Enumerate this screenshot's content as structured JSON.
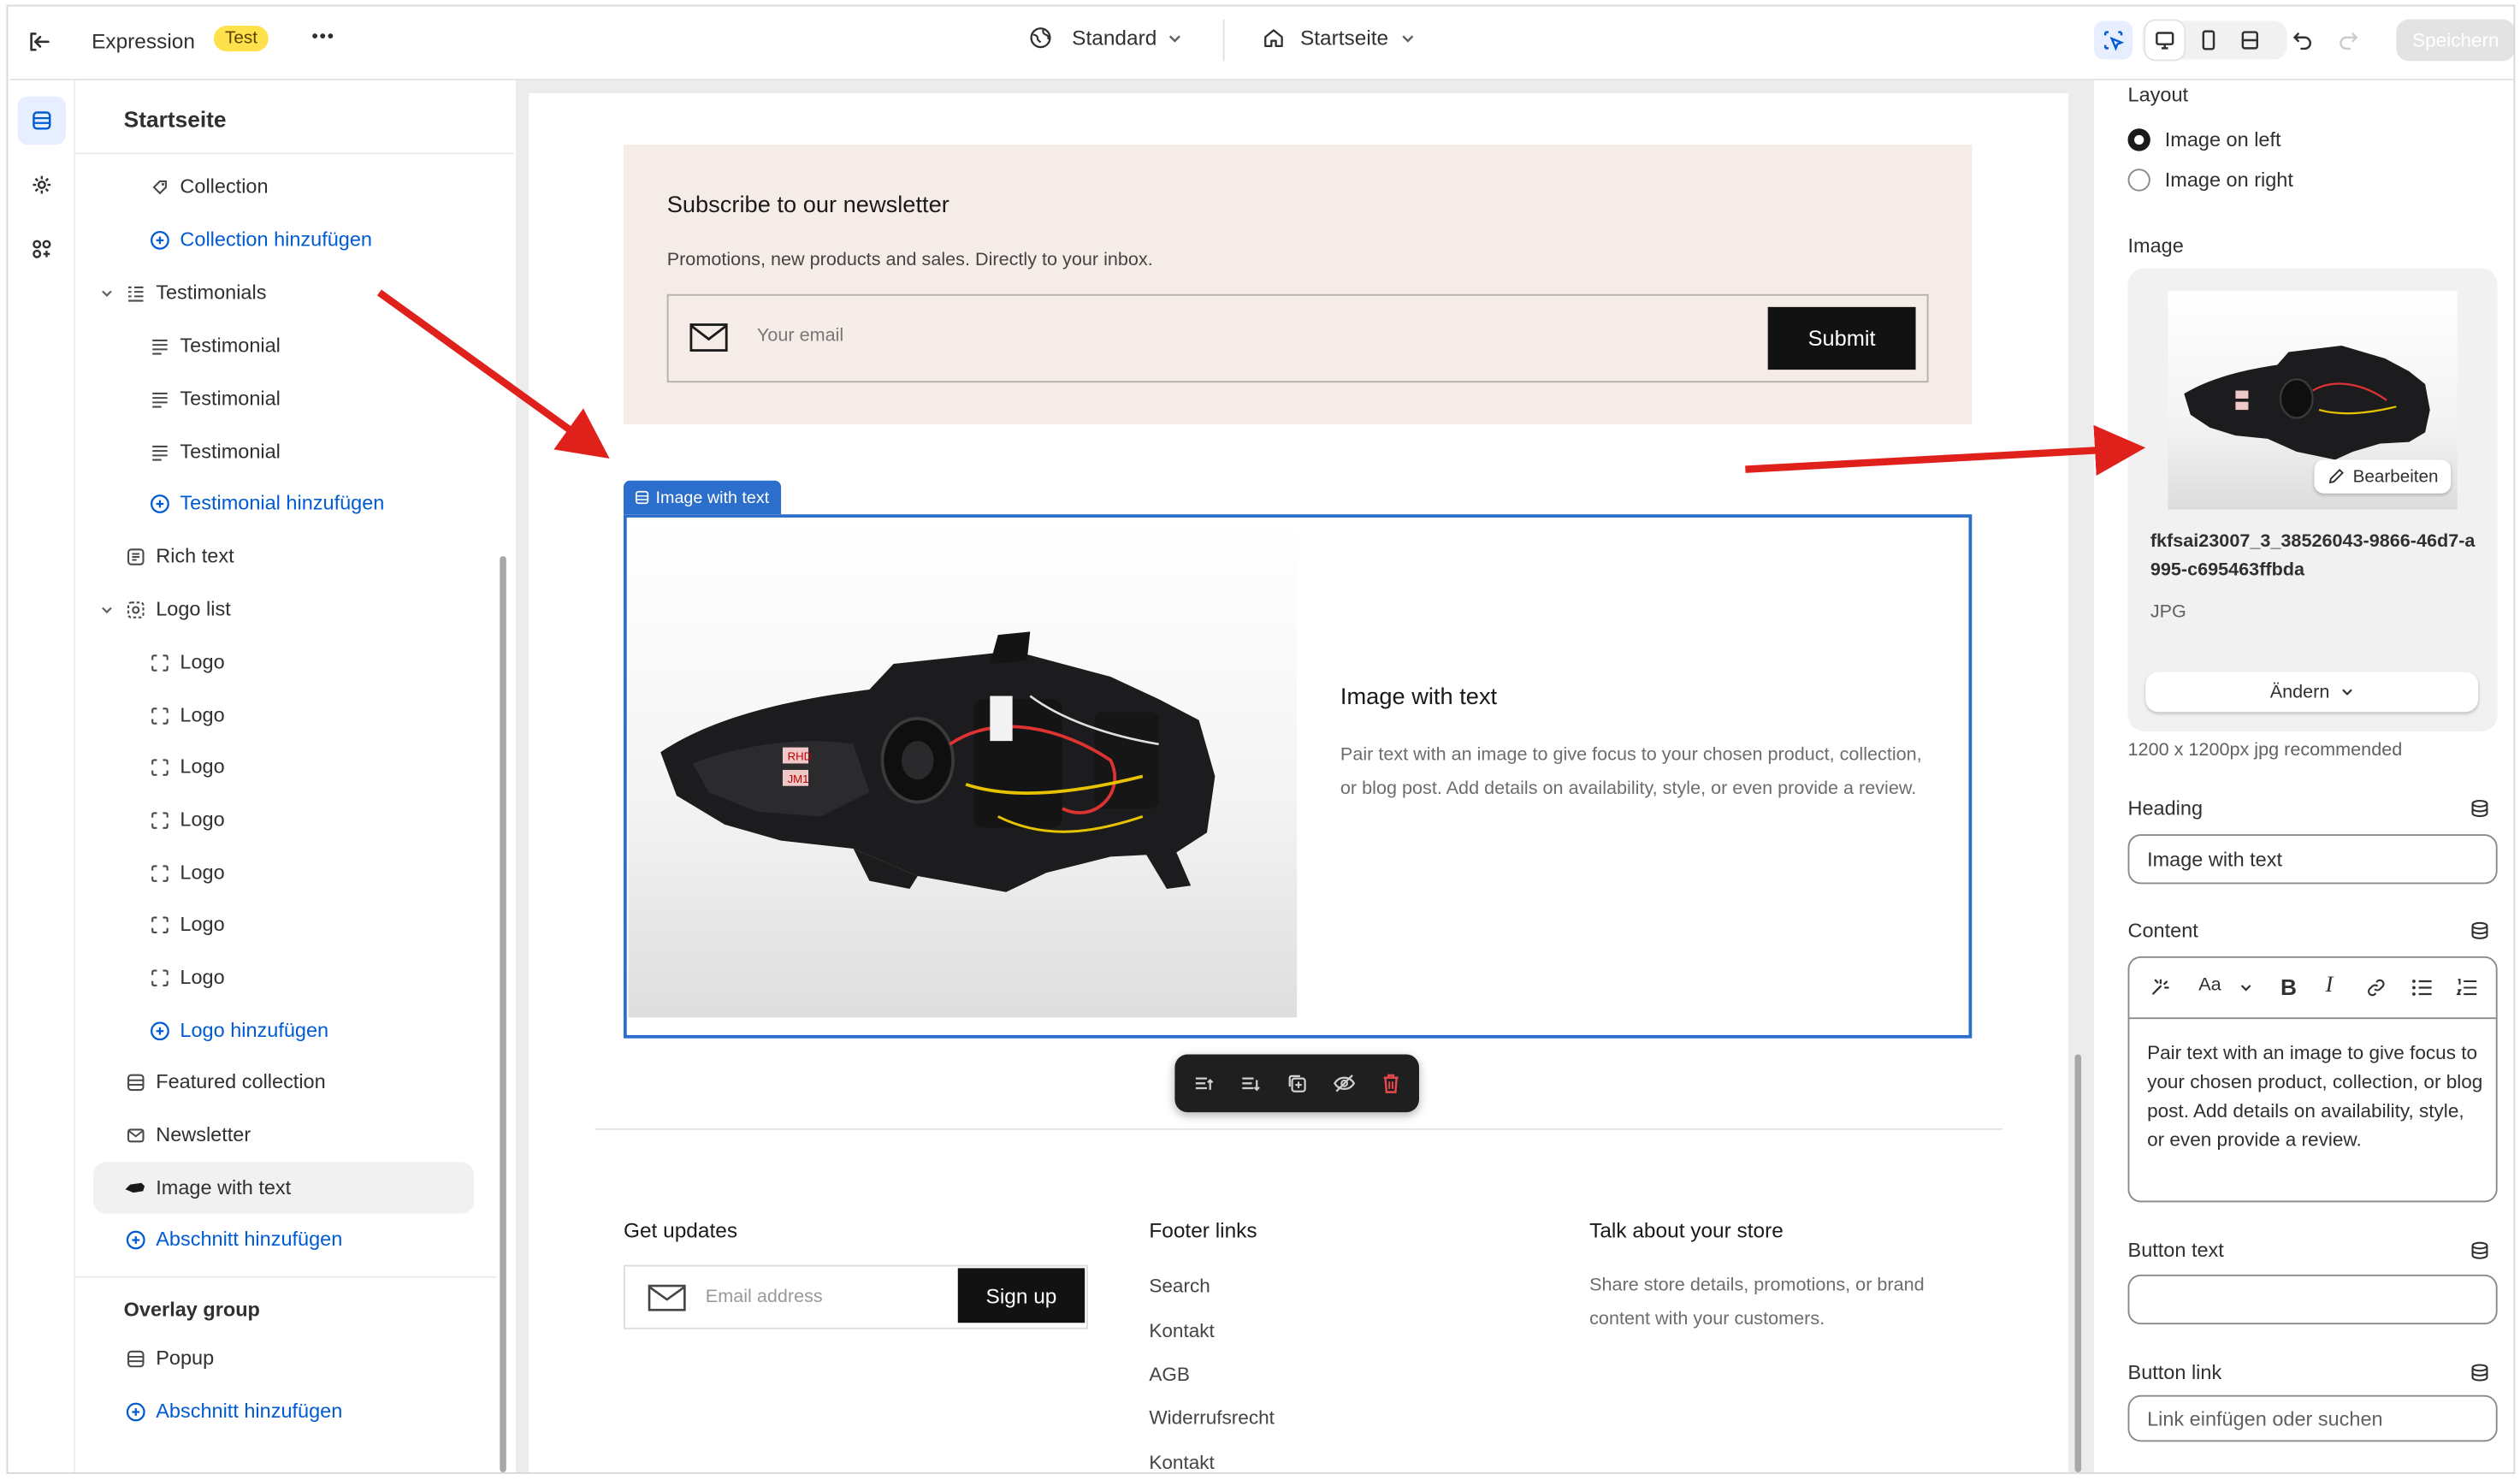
{
  "topbar": {
    "title": "Expression",
    "badge": "Test",
    "more": "•••",
    "theme_select": "Standard",
    "page_select": "Startseite",
    "save_label": "Speichern"
  },
  "left_panel": {
    "title": "Startseite",
    "items": [
      {
        "label": "Collection"
      },
      {
        "label": "Collection hinzufügen"
      },
      {
        "label": "Testimonials"
      },
      {
        "label": "Testimonial"
      },
      {
        "label": "Testimonial"
      },
      {
        "label": "Testimonial"
      },
      {
        "label": "Testimonial hinzufügen"
      },
      {
        "label": "Rich text"
      },
      {
        "label": "Logo list"
      },
      {
        "label": "Logo"
      },
      {
        "label": "Logo"
      },
      {
        "label": "Logo"
      },
      {
        "label": "Logo"
      },
      {
        "label": "Logo"
      },
      {
        "label": "Logo"
      },
      {
        "label": "Logo"
      },
      {
        "label": "Logo hinzufügen"
      },
      {
        "label": "Featured collection"
      },
      {
        "label": "Newsletter"
      },
      {
        "label": "Image with text"
      },
      {
        "label": "Abschnitt hinzufügen"
      }
    ],
    "overlay_group_title": "Overlay group",
    "overlay_items": [
      {
        "label": "Popup"
      },
      {
        "label": "Abschnitt hinzufügen"
      }
    ]
  },
  "canvas": {
    "newsletter": {
      "heading": "Subscribe to our newsletter",
      "subtext": "Promotions, new products and sales. Directly to your inbox.",
      "email_placeholder": "Your email",
      "submit_label": "Submit"
    },
    "section_tag": "Image with text",
    "image_with_text": {
      "heading": "Image with text",
      "body": "Pair text with an image to give focus to your chosen product, collection, or blog post. Add details on availability, style, or even provide a review.",
      "image_labels": [
        "RHD",
        "JM1"
      ]
    },
    "footer": {
      "updates_heading": "Get updates",
      "email_placeholder": "Email address",
      "signup_label": "Sign up",
      "links_heading": "Footer links",
      "links": [
        "Search",
        "Kontakt",
        "AGB",
        "Widerrufsrecht",
        "Kontakt"
      ],
      "talk_heading": "Talk about your store",
      "talk_text": "Share store details, promotions, or brand content with your customers."
    }
  },
  "right_panel": {
    "layout_label": "Layout",
    "layout_options": [
      "Image on left",
      "Image on right"
    ],
    "layout_selected": "Image on left",
    "image_label": "Image",
    "edit_label": "Bearbeiten",
    "filename": "fkfsai23007_3_38526043-9866-46d7-a995-c695463ffbda",
    "filetype": "JPG",
    "change_label": "Ändern",
    "image_hint": "1200 x 1200px jpg recommended",
    "heading_label": "Heading",
    "heading_value": "Image with text",
    "content_label": "Content",
    "content_toolbar_font": "Aa",
    "content_value": "Pair text with an image to give focus to your chosen product, collection, or blog post. Add details on availability, style, or even provide a review.",
    "button_text_label": "Button text",
    "button_text_value": "",
    "button_link_label": "Button link",
    "button_link_placeholder": "Link einfügen oder suchen"
  },
  "colors": {
    "accent_blue": "#005bd3",
    "selection_blue": "#2c6ecb",
    "annotation_red": "#e0201b",
    "newsletter_bg": "#f6ece7",
    "button_dark": "#121212",
    "badge_yellow": "#ffe24b"
  }
}
